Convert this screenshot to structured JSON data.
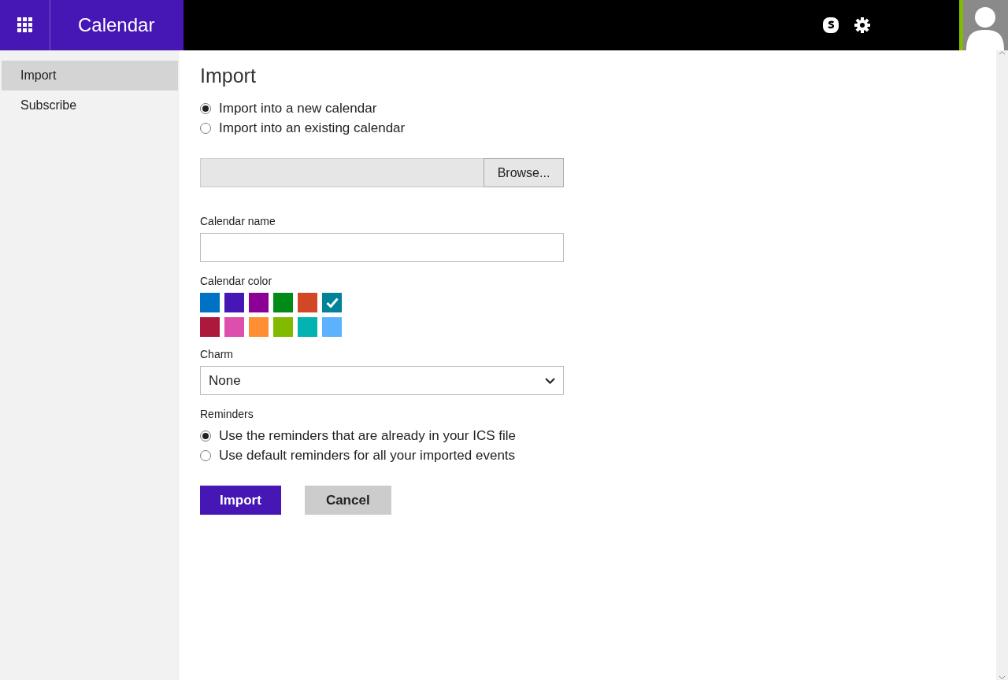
{
  "header": {
    "title": "Calendar"
  },
  "sidebar": {
    "items": [
      {
        "label": "Import",
        "selected": true
      },
      {
        "label": "Subscribe",
        "selected": false
      }
    ]
  },
  "page": {
    "title": "Import",
    "import_options": [
      {
        "label": "Import into a new calendar",
        "selected": true
      },
      {
        "label": "Import into an existing calendar",
        "selected": false
      }
    ],
    "browse_button": "Browse...",
    "calendar_name": {
      "label": "Calendar name"
    },
    "calendar_color": {
      "label": "Calendar color",
      "swatches": [
        {
          "color": "#0072c6",
          "selected": false
        },
        {
          "color": "#4617b4",
          "selected": false
        },
        {
          "color": "#8c0095",
          "selected": false
        },
        {
          "color": "#008a17",
          "selected": false
        },
        {
          "color": "#d24726",
          "selected": false
        },
        {
          "color": "#008299",
          "selected": true
        },
        {
          "color": "#ac193d",
          "selected": false
        },
        {
          "color": "#dc4fad",
          "selected": false
        },
        {
          "color": "#ff8f32",
          "selected": false
        },
        {
          "color": "#82ba00",
          "selected": false
        },
        {
          "color": "#03b3b2",
          "selected": false
        },
        {
          "color": "#5db2ff",
          "selected": false
        }
      ]
    },
    "charm": {
      "label": "Charm",
      "value": "None"
    },
    "reminders": {
      "label": "Reminders",
      "options": [
        {
          "label": "Use the reminders that are already in your ICS file",
          "selected": true
        },
        {
          "label": "Use default reminders for all your imported events",
          "selected": false
        }
      ]
    },
    "buttons": [
      {
        "label": "Import",
        "kind": "primary"
      },
      {
        "label": "Cancel",
        "kind": "secondary"
      }
    ]
  }
}
